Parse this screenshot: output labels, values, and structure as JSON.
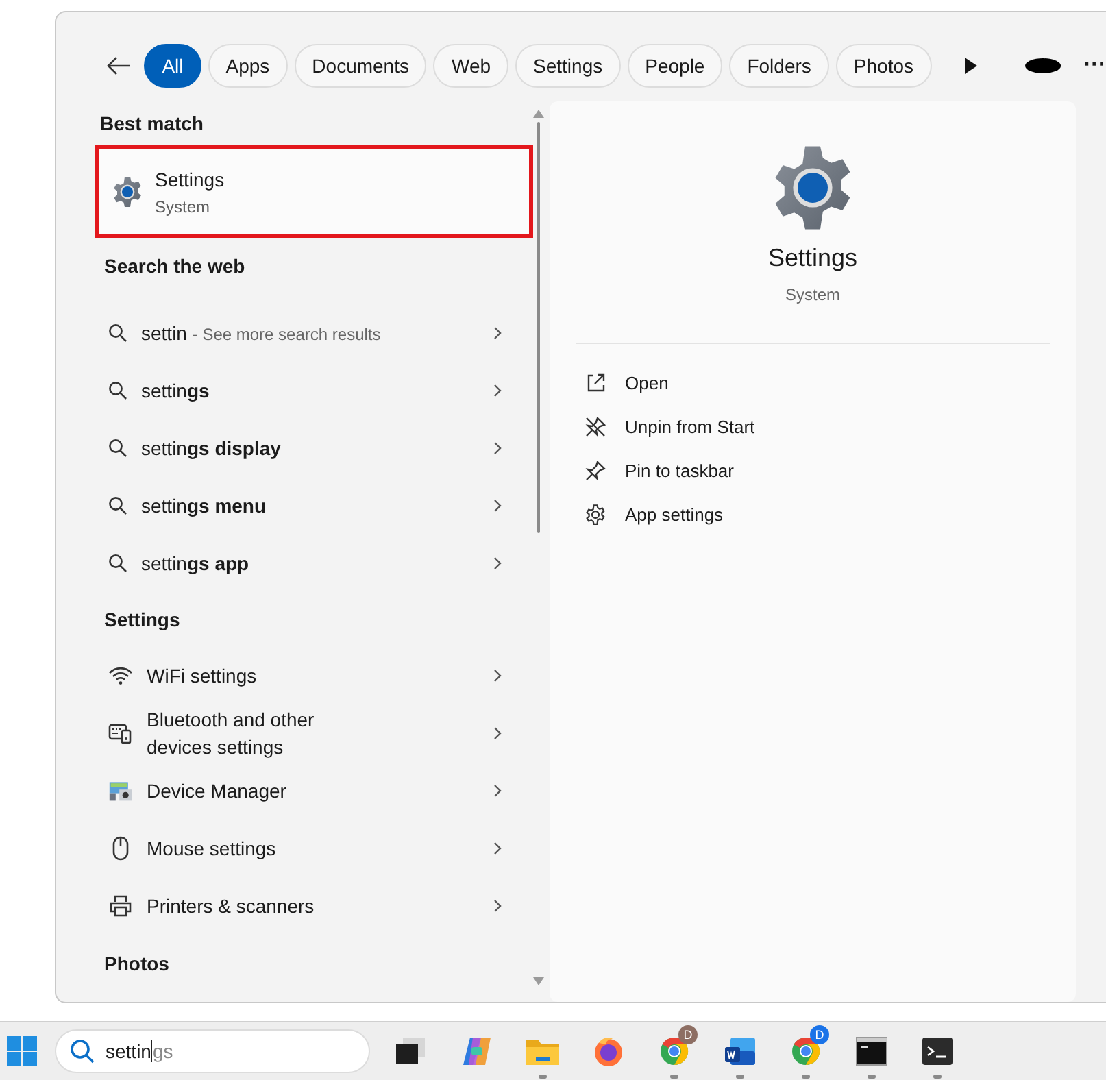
{
  "filters": [
    {
      "label": "All",
      "selected": true
    },
    {
      "label": "Apps",
      "selected": false
    },
    {
      "label": "Documents",
      "selected": false
    },
    {
      "label": "Web",
      "selected": false
    },
    {
      "label": "Settings",
      "selected": false
    },
    {
      "label": "People",
      "selected": false
    },
    {
      "label": "Folders",
      "selected": false
    },
    {
      "label": "Photos",
      "selected": false
    }
  ],
  "more_menu": "···",
  "best_match": {
    "heading": "Best match",
    "title": "Settings",
    "subtitle": "System",
    "highlighted": true
  },
  "web": {
    "heading": "Search the web",
    "items": [
      {
        "query": "settin",
        "hint": "- See more search results"
      },
      {
        "query": "settin**gs**"
      },
      {
        "query": "settin**gs display**"
      },
      {
        "query": "settin**gs menu**"
      },
      {
        "query": "settin**gs app**"
      }
    ]
  },
  "settings": {
    "heading": "Settings",
    "items": [
      {
        "kind": "wifi",
        "label": "WiFi settings"
      },
      {
        "kind": "bluetooth",
        "label": "Bluetooth and other devices settings"
      },
      {
        "kind": "device-manager",
        "label": "Device Manager"
      },
      {
        "kind": "mouse",
        "label": "Mouse settings"
      },
      {
        "kind": "printer",
        "label": "Printers & scanners"
      }
    ]
  },
  "photos": {
    "heading": "Photos"
  },
  "preview": {
    "title": "Settings",
    "subtitle": "System",
    "actions": [
      {
        "kind": "open",
        "label": "Open"
      },
      {
        "kind": "unpin",
        "label": "Unpin from Start"
      },
      {
        "kind": "pin",
        "label": "Pin to taskbar"
      },
      {
        "kind": "gear",
        "label": "App settings"
      }
    ]
  },
  "taskbar": {
    "search": {
      "typed": "settin",
      "suggestion": "gs"
    },
    "apps": [
      {
        "kind": "taskview",
        "running": false
      },
      {
        "kind": "copilot",
        "running": false
      },
      {
        "kind": "folder",
        "running": true
      },
      {
        "kind": "firefox",
        "running": false
      },
      {
        "kind": "chrome",
        "running": true,
        "badge": "D",
        "color": "#8d6e63"
      },
      {
        "kind": "word",
        "running": true
      },
      {
        "kind": "chrome",
        "running": true,
        "badge": "D",
        "color": "#1a73e8"
      },
      {
        "kind": "cmd",
        "running": true
      },
      {
        "kind": "terminal",
        "running": true
      }
    ]
  }
}
